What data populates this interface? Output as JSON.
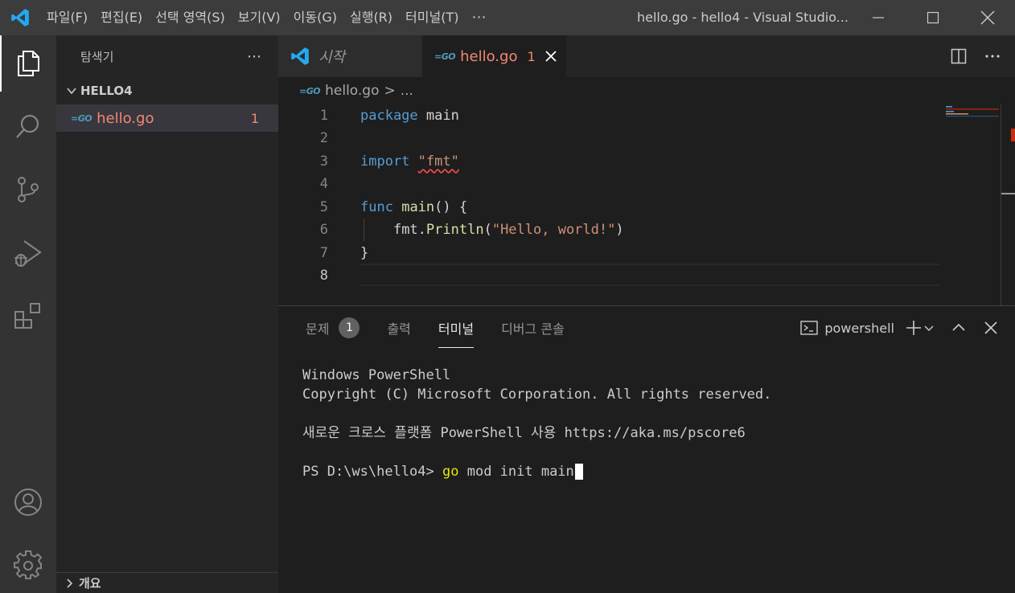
{
  "titlebar": {
    "menu": [
      "파일(F)",
      "편집(E)",
      "선택 영역(S)",
      "보기(V)",
      "이동(G)",
      "실행(R)",
      "터미널(T)",
      "⋯"
    ],
    "window_title": "hello.go - hello4 - Visual Studio..."
  },
  "sidebar": {
    "title": "탐색기",
    "more": "⋯",
    "folder": "HELLO4",
    "file": {
      "name": "hello.go",
      "problems": "1"
    },
    "outline": "개요"
  },
  "tabs": [
    {
      "label": "시작"
    },
    {
      "label": "hello.go",
      "badge": "1"
    }
  ],
  "breadcrumb": {
    "file": "hello.go",
    "sep": ">",
    "more": "..."
  },
  "editor": {
    "line_numbers": [
      "1",
      "2",
      "3",
      "4",
      "5",
      "6",
      "7",
      "8"
    ],
    "current_line": "8",
    "tokens": {
      "l1_kw": "package",
      "l1_id": "main",
      "l3_kw": "import",
      "l3_str": "\"fmt\"",
      "l5_kw": "func",
      "l5_fn": "main",
      "l5_rest": "() {",
      "l6_pkg": "fmt",
      "l6_dot": ".",
      "l6_fn": "Println",
      "l6_open": "(",
      "l6_str": "\"Hello, world!\"",
      "l6_close": ")",
      "l7": "}"
    }
  },
  "panel": {
    "tabs": [
      "문제",
      "출력",
      "터미널",
      "디버그 콘솔"
    ],
    "problems_count": "1",
    "active_tab": "터미널",
    "shell": "powershell",
    "terminal": {
      "line1": "Windows PowerShell",
      "line2": "Copyright (C) Microsoft Corporation. All rights reserved.",
      "line3": "새로운 크로스 플랫폼 PowerShell 사용 https://aka.ms/pscore6",
      "prompt": "PS D:\\ws\\hello4> ",
      "cmd_go": "go",
      "cmd_rest": " mod init main"
    }
  },
  "colors": {
    "accent_error": "#f48771",
    "keyword": "#569cd6",
    "function": "#dcdcaa",
    "string": "#ce9178",
    "vscode_blue": "#23a9f2"
  }
}
